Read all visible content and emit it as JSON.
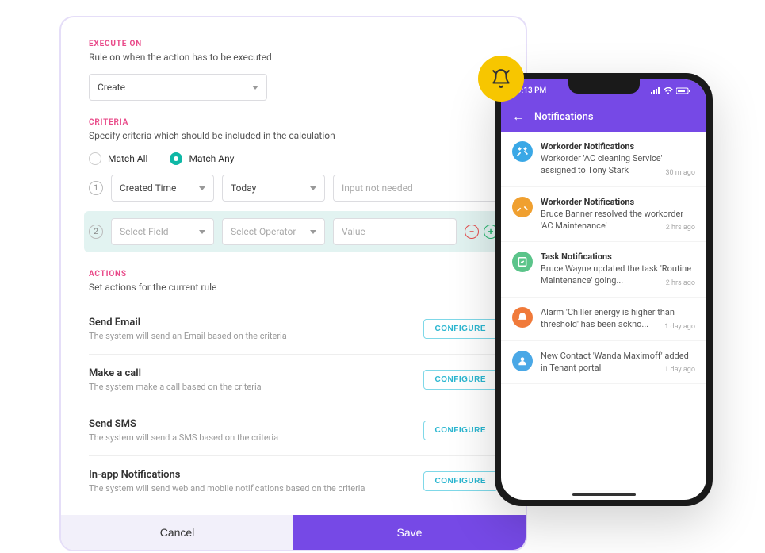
{
  "execute": {
    "label": "EXECUTE ON",
    "desc": "Rule on when the action has to be executed",
    "select_value": "Create"
  },
  "criteria": {
    "label": "CRITERIA",
    "desc": "Specify criteria which should be included in the calculation",
    "match_all": "Match All",
    "match_any": "Match Any",
    "rows": [
      {
        "num": "1",
        "field": "Created Time",
        "operator": "Today",
        "value": "Input not needed"
      },
      {
        "num": "2",
        "field": "Select Field",
        "operator": "Select Operator",
        "value": "Value"
      }
    ]
  },
  "actions": {
    "label": "ACTIONS",
    "desc": "Set actions for the current rule",
    "configure_label": "CONFIGURE",
    "items": [
      {
        "title": "Send Email",
        "desc": "The system will send an Email based on the criteria"
      },
      {
        "title": "Make a call",
        "desc": "The system make a call based on the criteria"
      },
      {
        "title": "Send SMS",
        "desc": "The system will send a SMS based on the criteria"
      },
      {
        "title": "In-app Notifications",
        "desc": "The system will send web and mobile notifications based on the criteria"
      }
    ]
  },
  "buttons": {
    "cancel": "Cancel",
    "save": "Save"
  },
  "phone": {
    "time": "9:13 PM",
    "header": "Notifications",
    "notifs": [
      {
        "title": "Workorder Notifications",
        "text": "Workorder 'AC cleaning Service' assigned to Tony Stark",
        "time": "30 m ago",
        "color": "#3aa8e6",
        "icon": "tools"
      },
      {
        "title": "Workorder Notifications",
        "text": "Bruce Banner resolved the workorder 'AC Maintenance'",
        "time": "2 hrs ago",
        "color": "#f0a030",
        "icon": "tools"
      },
      {
        "title": "Task Notifications",
        "text": "Bruce Wayne updated the task 'Routine Maintenance' going...",
        "time": "2 hrs ago",
        "color": "#5bc48a",
        "icon": "task"
      },
      {
        "title": "",
        "text": "Alarm 'Chiller energy is higher than threshold' has been ackno...",
        "time": "1 day ago",
        "color": "#f07a3a",
        "icon": "alarm"
      },
      {
        "title": "",
        "text": "New Contact 'Wanda Maximoff' added in Tenant portal",
        "time": "1 day ago",
        "color": "#4aa8e6",
        "icon": "user"
      }
    ]
  }
}
